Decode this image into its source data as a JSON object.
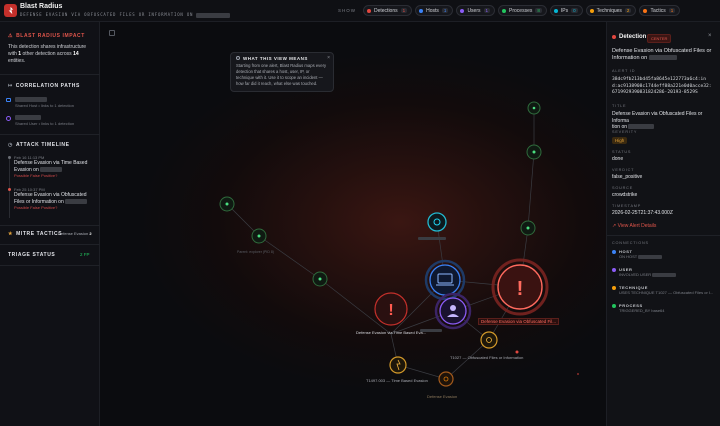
{
  "app": {
    "title": "Blast Radius",
    "subtitle": "DEFENSE EVASION VIA OBFUSCATED FILES OR INFORMATION ON"
  },
  "toolbar": {
    "show_label": "SHOW",
    "filters": [
      {
        "label": "Detections",
        "count": "1",
        "color": "#e2473f"
      },
      {
        "label": "Hosts",
        "count": "1",
        "color": "#3b82f6"
      },
      {
        "label": "Users",
        "count": "1",
        "color": "#8b5cf6"
      },
      {
        "label": "Processes",
        "count": "8",
        "color": "#22c55e"
      },
      {
        "label": "IPs",
        "count": "0",
        "color": "#06b6d4"
      },
      {
        "label": "Techniques",
        "count": "2",
        "color": "#f59e0b"
      },
      {
        "label": "Tactics",
        "count": "1",
        "color": "#f97316"
      }
    ]
  },
  "left": {
    "impact_title": "BLAST RADIUS IMPACT",
    "impact_text_1": "This detection shares infrastructure",
    "impact_text_2a": "with",
    "impact_count": "1",
    "impact_text_2b": "other detection across",
    "impact_entities": "14",
    "impact_text_3": "entities.",
    "correlation_title": "CORRELATION PATHS",
    "corr_1_sub": "Shared Host • links to 1 detection",
    "corr_2_sub": "Shared User • links to 1 detection",
    "timeline_title": "ATTACK TIMELINE",
    "tl_1_date": "Feb 16 11:13 PM",
    "tl_1_title_1": "Defense Evasion via Time Based",
    "tl_1_title_2": "Evasion on",
    "tl_1_link": "Possible False Positive?",
    "tl_2_date": "Feb 25 10:37 PM",
    "tl_2_title_1": "Defense Evasion via Obfuscated",
    "tl_2_title_2": "Files or Information on",
    "tl_2_link": "Possible False Positive?",
    "mitre_title": "MITRE TACTICS",
    "mitre_value": "Defense Evasion",
    "mitre_count": "2",
    "triage_title": "TRIAGE STATUS",
    "triage_value": "2 FP"
  },
  "info_card": {
    "title": "WHAT THIS VIEW MEANS",
    "line_1": "Starting from one alert, Blast Radius maps every",
    "line_2": "detection that shares a host, user, IP, or",
    "line_3": "technique with it. Use it to scope an incident —",
    "line_4": "how far did it reach, what else was touched."
  },
  "graph_labels": {
    "time_based": "Defense Evasion via Time Based Eva...",
    "obfuscated": "Defense Evasion via Obfuscated Fil...",
    "t1027": "T1027 — Obfuscated Files or Information",
    "t1497": "T1497.003 — Time Based Evasion",
    "tactic": "Defense Evasion",
    "powershell": "Parent: explorer (PID 8)"
  },
  "right": {
    "header": "Detection",
    "header_badge": "CENTER",
    "title_1": "Defense Evasion via Obfuscated Files or",
    "title_2": "Information on",
    "alert_id_label": "ALERT ID",
    "alert_id_1": "38dc9fb213bd45fa8645e122773a6c4:in",
    "alert_id_2": "d:ac9138908c1744eff88a221e0d0acce32:",
    "alert_id_3": "6719929390831824286-20193-8529S",
    "title_label": "TITLE",
    "title_val_1": "Defense Evasion via Obfuscated Files or Informa",
    "title_val_2": "tion on",
    "severity_label": "SEVERITY",
    "severity_val": "High",
    "status_label": "STATUS",
    "status_val": "done",
    "verdict_label": "VERDICT",
    "verdict_val": "false_positive",
    "source_label": "SOURCE",
    "source_val": "crowdstrike",
    "timestamp_label": "TIMESTAMP",
    "timestamp_val": "2026-02-25T21:37:43.000Z",
    "view_link": "View Alert Details",
    "connections_label": "CONNECTIONS",
    "host_label": "HOST",
    "host_sub": "ON HOST",
    "user_label": "USER",
    "user_sub": "INVOLVED USER",
    "technique_label": "TECHNIQUE",
    "technique_sub": "USES TECHNIQUE  T1027 — Obfuscated Files or I...",
    "process_label": "PROCESS",
    "process_sub": "TRIGGERED_BY  base64"
  }
}
